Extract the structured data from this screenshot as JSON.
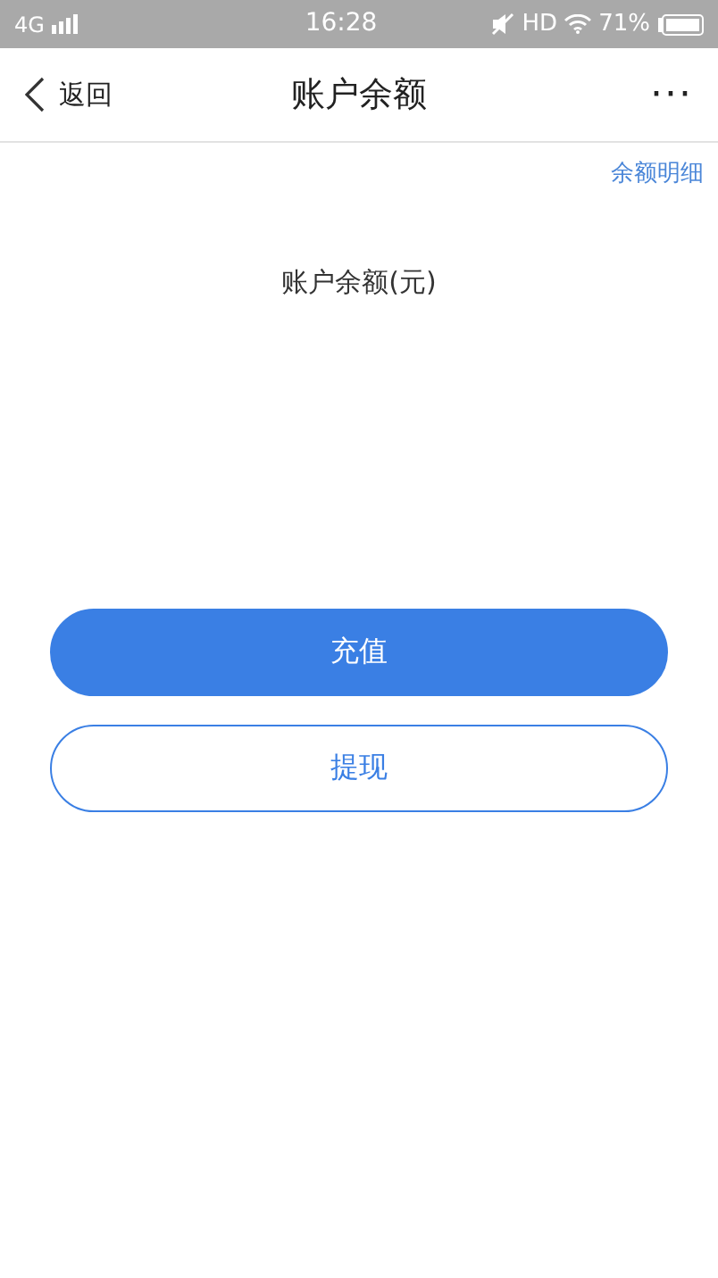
{
  "status_bar": {
    "network": "4G",
    "time": "16:28",
    "hd": "HD",
    "battery": "71%"
  },
  "header": {
    "back": "返回",
    "title": "账户余额",
    "more": "···"
  },
  "detail_link": "余额明细",
  "balance_label": "账户余额(元)",
  "buttons": [
    {
      "label": "充值",
      "kind": "primary"
    },
    {
      "label": "提现",
      "kind": "outline"
    }
  ]
}
